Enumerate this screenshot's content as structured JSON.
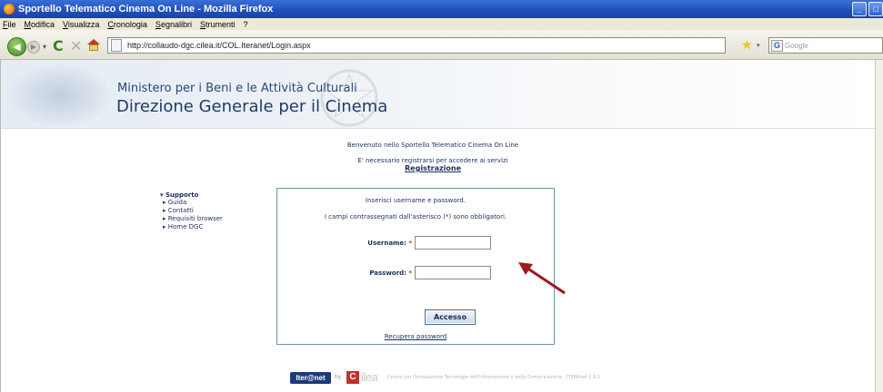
{
  "window": {
    "title": "Sportello Telematico Cinema On Line - Mozilla Firefox",
    "controls": [
      "_",
      "□"
    ]
  },
  "menu": [
    "File",
    "Modifica",
    "Visualizza",
    "Cronologia",
    "Segnalibri",
    "Strumenti",
    "?"
  ],
  "toolbar": {
    "url": "http://collaudo-dgc.cilea.it/COL.Iteranet/Login.aspx",
    "search_placeholder": "Google",
    "search_engine_letter": "G",
    "reload_glyph": "C",
    "stop_glyph": "✕"
  },
  "header": {
    "ministry": "Ministero per i Beni e le Attività Culturali",
    "direzione": "Direzione Generale per il Cinema"
  },
  "leftnav": {
    "heading": "▾ Supporto",
    "items": [
      "▸ Guida",
      "▸ Contatti",
      "▸ Requisiti browser",
      "▸ Home DGC"
    ]
  },
  "welcome": {
    "line1": "Benvenuto nello Sportello Telematico Cinema On Line",
    "line2": "E' necessario registrarsi per accedere ai servizi",
    "register_link": "Registrazione"
  },
  "login": {
    "instruction": "Inserisci username e password.",
    "required_note": "I campi contrassegnati dall'asterisco (*) sono obbligatori.",
    "username_label": "Username:",
    "password_label": "Password:",
    "required_mark": "*",
    "username_value": "",
    "password_value": "",
    "submit_label": "Accesso",
    "recover_link": "Recupera password"
  },
  "footer": {
    "iteronet_logo": "Iter@net",
    "by": "by",
    "cilea_mark": "C",
    "cilea_word": "ilea",
    "text": "Centro per l'Innovazione Tecnologie dell'Informazione e della Comunicazione - ITERAnet 1.9.2"
  },
  "colors": {
    "titlebar": "#1f4fb8",
    "link_text": "#1a2f5a",
    "box_border": "#6d93a4",
    "arrow": "#9b1b1b"
  }
}
